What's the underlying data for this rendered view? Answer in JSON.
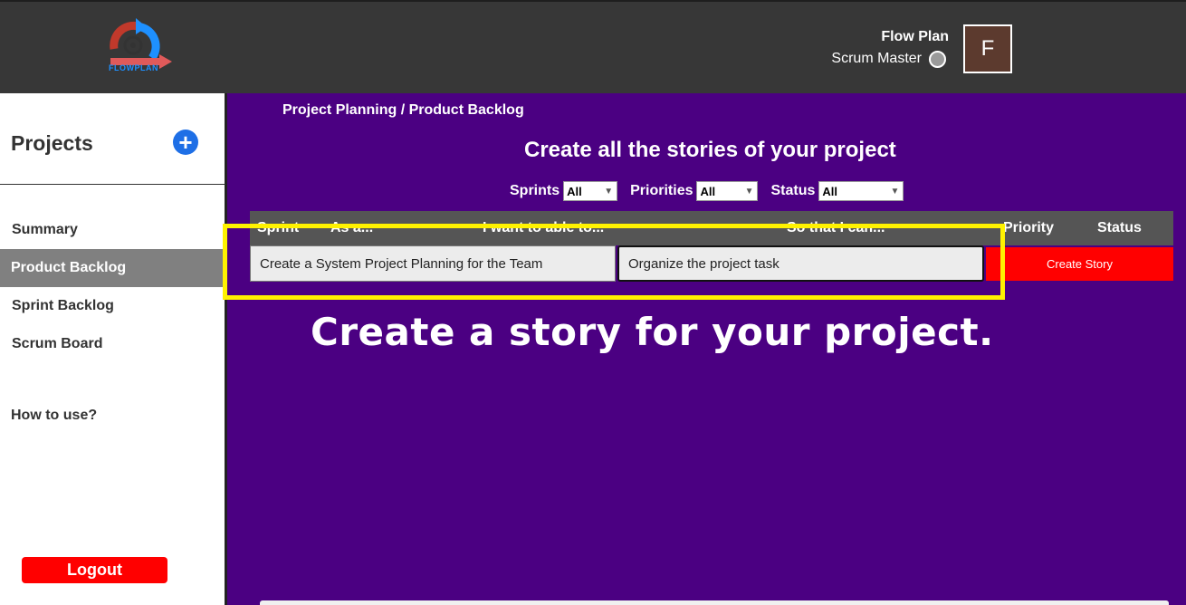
{
  "header": {
    "logo_text": "FLOWPLAN",
    "app_name": "Flow Plan",
    "role": "Scrum Master",
    "avatar_initial": "F"
  },
  "sidebar": {
    "title": "Projects",
    "add_label": "+",
    "items": [
      {
        "label": "Summary"
      },
      {
        "label": "Product Backlog"
      },
      {
        "label": "Sprint Backlog"
      },
      {
        "label": "Scrum Board"
      }
    ],
    "howto": "How to use?",
    "logout": "Logout"
  },
  "main": {
    "breadcrumb": "Project Planning / Product Backlog",
    "heading": "Create all the stories of your project",
    "filters": [
      {
        "label": "Sprints",
        "value": "All"
      },
      {
        "label": "Priorities",
        "value": "All"
      },
      {
        "label": "Status",
        "value": "All"
      }
    ],
    "table": {
      "columns": [
        "Sprint",
        "As a...",
        "I want to able to...",
        "So that I can...",
        "Priority",
        "Status"
      ],
      "row": {
        "want_value": "Create a System Project Planning for the Team",
        "so_that_value": "Organize the project task",
        "create_label": "Create Story"
      }
    },
    "tutorial": "Create a story for your project."
  },
  "colors": {
    "accent": "#4b0082",
    "highlight": "#fff200",
    "danger": "#ff0000",
    "topbar": "#373737"
  }
}
